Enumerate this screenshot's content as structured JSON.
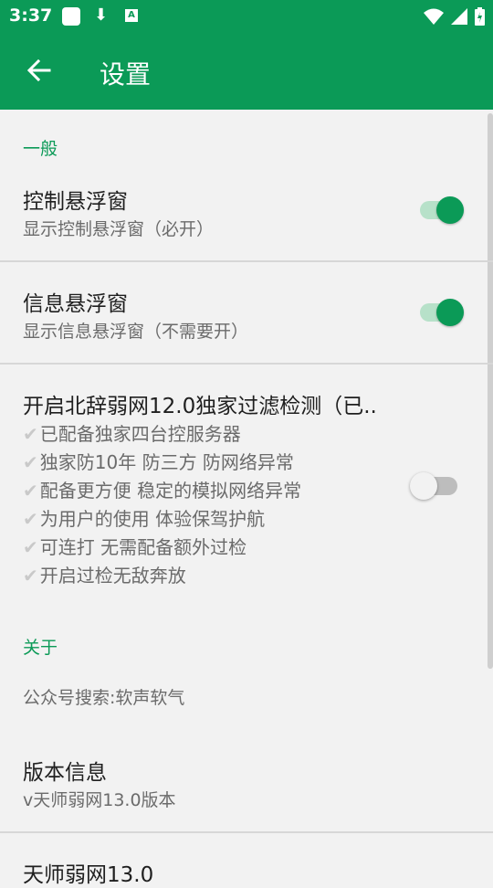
{
  "status_bar": {
    "time": "3:37",
    "download_glyph": "⬇",
    "a_glyph": "A",
    "icons": [
      "app-icon",
      "download-icon",
      "a-icon",
      "wifi-icon",
      "signal-icon",
      "battery-icon"
    ]
  },
  "toolbar": {
    "title": "设置",
    "back_icon": "arrow-left-icon",
    "color": "#0b9a57"
  },
  "general": {
    "header": "一般",
    "items": [
      {
        "title": "控制悬浮窗",
        "subtitle": "显示控制悬浮窗（必开）",
        "enabled": true
      },
      {
        "title": "信息悬浮窗",
        "subtitle": "显示信息悬浮窗（不需要开）",
        "enabled": true
      }
    ],
    "filter": {
      "title": "开启北辞弱网12.0独家过滤检测（已..",
      "check_mark": "✔",
      "lines": [
        "已配备独家四台控服务器",
        "独家防10年 防三方 防网络异常",
        "配备更方便 稳定的模拟网络异常",
        "为用户的使用 体验保驾护航",
        "可连打 无需配备额外过检",
        "开启过检无敌奔放"
      ],
      "enabled": false
    }
  },
  "about": {
    "header": "关于",
    "wechat": "公众号搜索:软声软气",
    "version_title": "版本信息",
    "version_sub": "v天师弱网13.0版本",
    "next_title": "天师弱网13.0"
  },
  "colors": {
    "accent": "#0b9a57",
    "background": "#f2f2f2"
  }
}
